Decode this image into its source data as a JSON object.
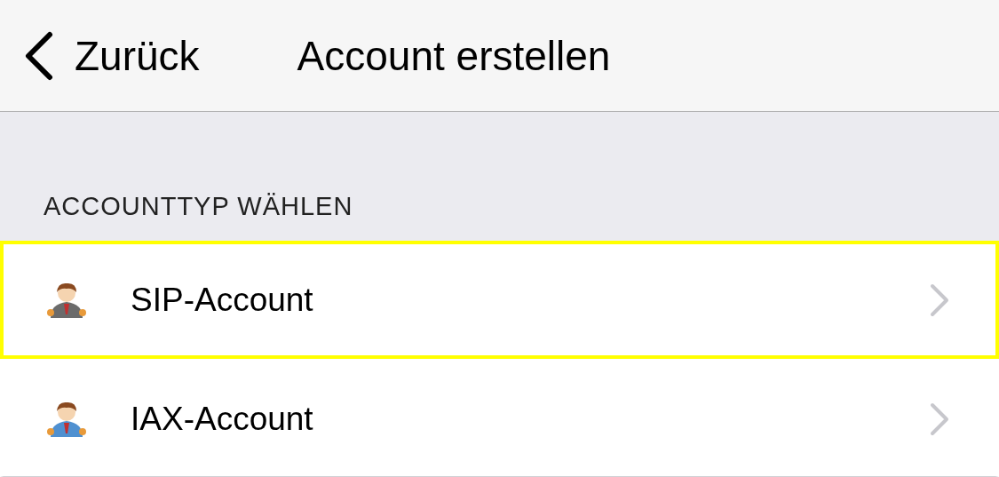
{
  "nav_bar": {
    "back": "Zurück",
    "title": "Account erstellen"
  },
  "section": {
    "header": "ACCOUNTTYP WÄHLEN",
    "items": [
      {
        "label": "SIP-Account",
        "color": "#6b6b6b",
        "highlighted": true
      },
      {
        "label": "IAX-Account",
        "color": "#4f90d0",
        "highlighted": false
      }
    ]
  }
}
